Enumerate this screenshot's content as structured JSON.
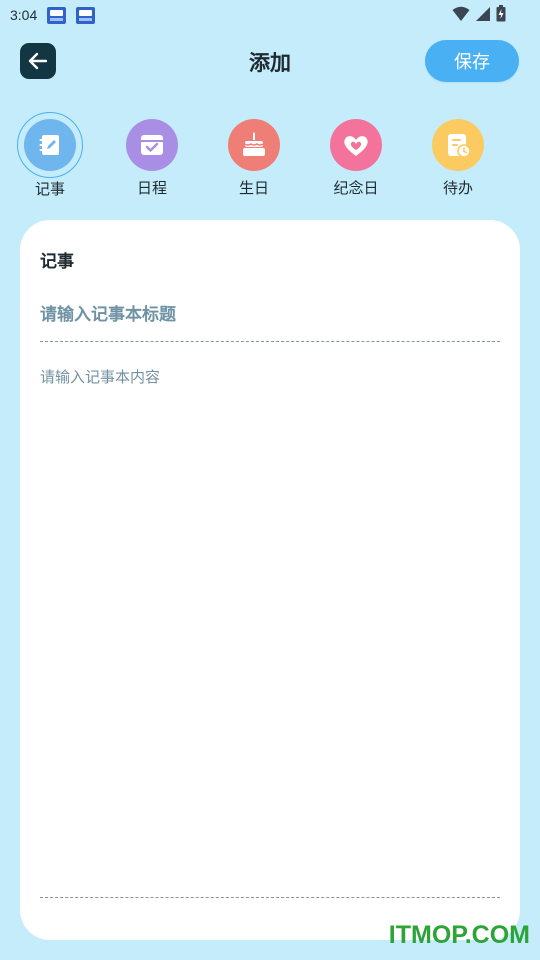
{
  "status_bar": {
    "time": "3:04",
    "notification_icons": [
      "app-notification-icon",
      "app-notification-icon"
    ],
    "system_icons": [
      "wifi-icon",
      "signal-icon",
      "battery-icon"
    ]
  },
  "header": {
    "title": "添加",
    "save_label": "保存",
    "back_icon": "arrow-left-icon"
  },
  "categories": [
    {
      "label": "记事",
      "icon": "notebook-icon",
      "color": "#6fb6ef",
      "active": true
    },
    {
      "label": "日程",
      "icon": "calendar-check-icon",
      "color": "#a98ee6",
      "active": false
    },
    {
      "label": "生日",
      "icon": "birthday-cake-icon",
      "color": "#ef7e76",
      "active": false
    },
    {
      "label": "纪念日",
      "icon": "heart-icon",
      "color": "#f4739c",
      "active": false
    },
    {
      "label": "待办",
      "icon": "todo-clock-icon",
      "color": "#fbcb61",
      "active": false
    }
  ],
  "editor": {
    "section_title": "记事",
    "title_value": "",
    "title_placeholder": "请输入记事本标题",
    "content_value": "",
    "content_placeholder": "请输入记事本内容"
  },
  "watermark": "ITMOP.COM",
  "colors": {
    "background": "#c4ecfb",
    "accent": "#4ab0f4",
    "back_button": "#123642",
    "card": "#ffffff"
  }
}
